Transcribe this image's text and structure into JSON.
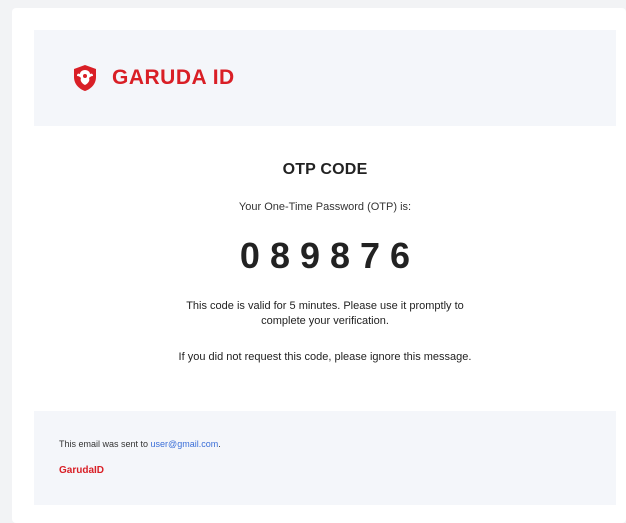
{
  "header": {
    "logo_icon": "garuda-shield-icon",
    "logo_text": "GARUDA ID"
  },
  "main": {
    "title": "OTP CODE",
    "intro": "Your One-Time Password (OTP) is:",
    "otp_code": "089876",
    "validity_line1": "This code is valid for 5 minutes. Please use it promptly to",
    "validity_line2": "complete your verification.",
    "ignore_note": "If you did not request this code, please ignore this message."
  },
  "footer": {
    "sent_prefix": "This email was sent to ",
    "email": "user@gmail.com",
    "sent_suffix": ".",
    "brand": "GarudaID"
  },
  "colors": {
    "brand_red": "#d91f26",
    "panel_bg": "#f4f6fa",
    "link_blue": "#3b6fd8"
  }
}
